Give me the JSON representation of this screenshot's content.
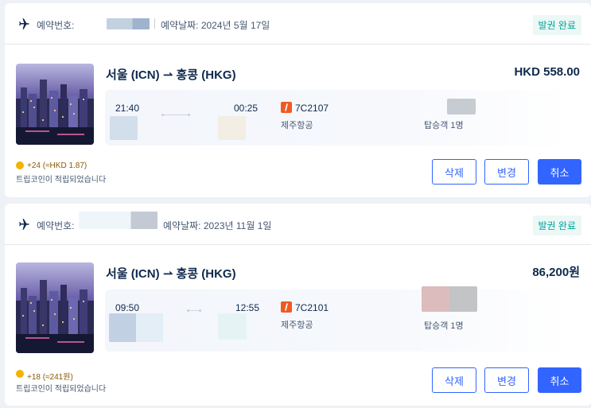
{
  "bookings": [
    {
      "booking_no_label": "예약번호:",
      "booking_date": "예약날짜: 2024년 5월 17일",
      "status": "발권 완료",
      "route": "서울 (ICN) ⇀ 홍콩 (HKG)",
      "price": "HKD 558.00",
      "depart_time": "21:40",
      "arrive_time": "00:25",
      "flight_no": "7C2107",
      "airline": "제주항공",
      "passengers": "탑승객 1명",
      "coin_amount": "+24 (≈HKD 1.87)",
      "coin_note": "트립코인이 적립되었습니다",
      "buttons": {
        "delete": "삭제",
        "change": "변경",
        "cancel": "취소"
      }
    },
    {
      "booking_no_label": "예약번호:",
      "booking_date": "예약날짜: 2023년 11월 1일",
      "status": "발권 완료",
      "route": "서울 (ICN) ⇀ 홍콩 (HKG)",
      "price": "86,200원",
      "depart_time": "09:50",
      "arrive_time": "12:55",
      "flight_no": "7C2101",
      "airline": "제주항공",
      "passengers": "탑승객 1명",
      "coin_amount": "+18 (≈241원)",
      "coin_note": "트립코인이 적립되었습니다",
      "buttons": {
        "delete": "삭제",
        "change": "변경",
        "cancel": "취소"
      }
    }
  ],
  "colors": {
    "accent": "#3264ff",
    "status_bg": "#ebf8f6",
    "status_text": "#00a19a",
    "airline_logo": "#f05a22",
    "coin": "#f5b300"
  },
  "icons": {
    "plane": "airplane-icon",
    "coin": "trip-coin-icon",
    "airline": "jeju-air-logo"
  }
}
